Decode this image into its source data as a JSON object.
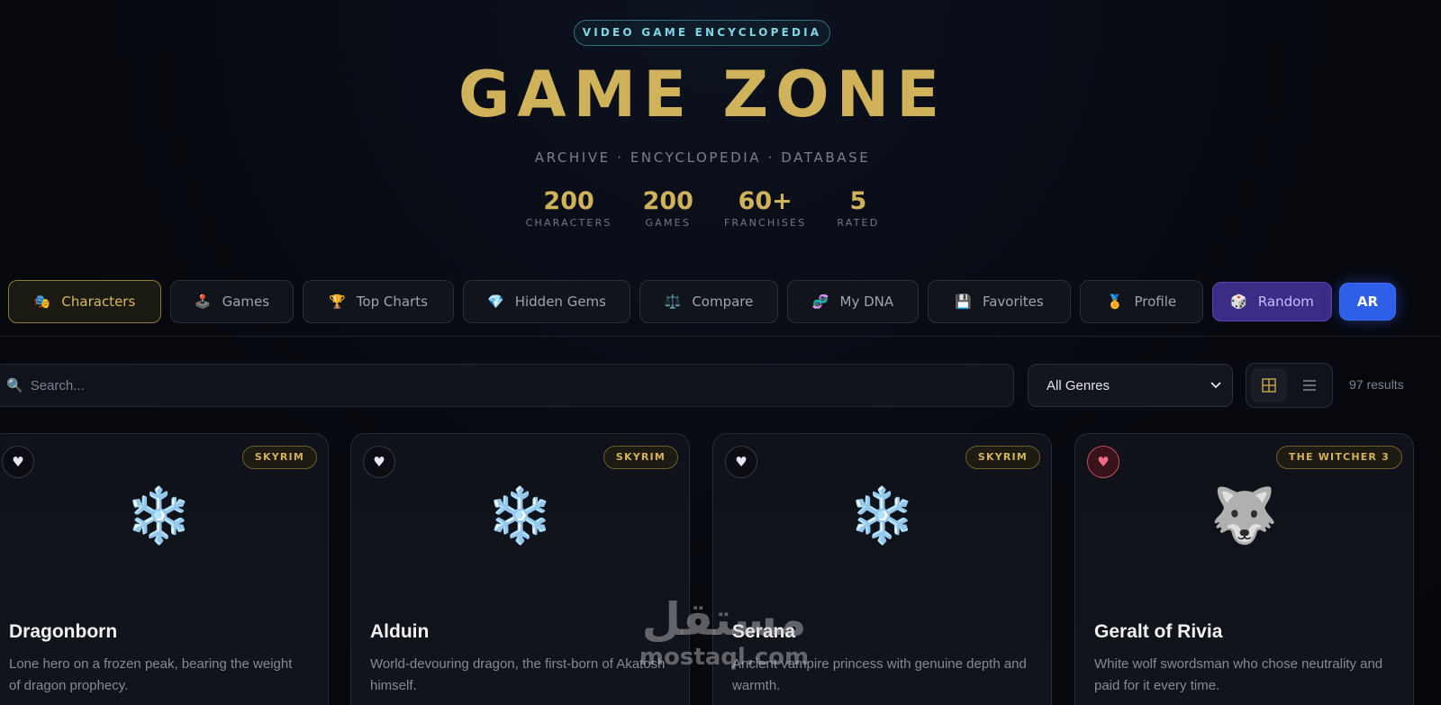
{
  "hero": {
    "badge": "VIDEO GAME ENCYCLOPEDIA",
    "title": "GAME ZONE",
    "subtitle": "ARCHIVE · ENCYCLOPEDIA · DATABASE",
    "stats": [
      {
        "value": "200",
        "label": "CHARACTERS"
      },
      {
        "value": "200",
        "label": "GAMES"
      },
      {
        "value": "60+",
        "label": "FRANCHISES"
      },
      {
        "value": "5",
        "label": "RATED"
      }
    ]
  },
  "nav": {
    "tabs": [
      {
        "label": "Characters",
        "icon": "🎭",
        "icon_name": "theater-masks-icon"
      },
      {
        "label": "Games",
        "icon": "🕹️",
        "icon_name": "joystick-icon"
      },
      {
        "label": "Top Charts",
        "icon": "🏆",
        "icon_name": "trophy-icon"
      },
      {
        "label": "Hidden Gems",
        "icon": "💎",
        "icon_name": "gem-icon"
      },
      {
        "label": "Compare",
        "icon": "⚖️",
        "icon_name": "scales-icon"
      },
      {
        "label": "My DNA",
        "icon": "🧬",
        "icon_name": "dna-icon"
      },
      {
        "label": "Favorites",
        "icon": "💾",
        "icon_name": "floppy-disk-icon"
      },
      {
        "label": "Profile",
        "icon": "🏅",
        "icon_name": "medal-icon"
      },
      {
        "label": "Random",
        "icon": "🎲",
        "icon_name": "dice-icon"
      }
    ],
    "lang_button": "AR",
    "active_tab": "Characters"
  },
  "filters": {
    "search_placeholder": "Search...",
    "genre_selected": "All Genres",
    "view_mode": "grid",
    "results": "97 results"
  },
  "cards": [
    {
      "name": "Dragonborn",
      "game": "SKYRIM",
      "emoji": "❄️",
      "favorite": false,
      "desc": "Lone hero on a frozen peak, bearing the weight of dragon prophecy."
    },
    {
      "name": "Alduin",
      "game": "SKYRIM",
      "emoji": "❄️",
      "favorite": false,
      "desc": "World-devouring dragon, the first-born of Akatosh himself."
    },
    {
      "name": "Serana",
      "game": "SKYRIM",
      "emoji": "❄️",
      "favorite": false,
      "desc": "Ancient vampire princess with genuine depth and warmth."
    },
    {
      "name": "Geralt of Rivia",
      "game": "THE WITCHER 3",
      "emoji": "🐺",
      "favorite": true,
      "desc": "White wolf swordsman who chose neutrality and paid for it every time."
    }
  ],
  "watermark": {
    "arabic": "مستقل",
    "latin": "mostaql.com"
  },
  "colors": {
    "gold": "#d0b25a",
    "accent_blue": "#2f5ee9",
    "accent_purple": "#3b2d86",
    "background": "#07090f"
  }
}
